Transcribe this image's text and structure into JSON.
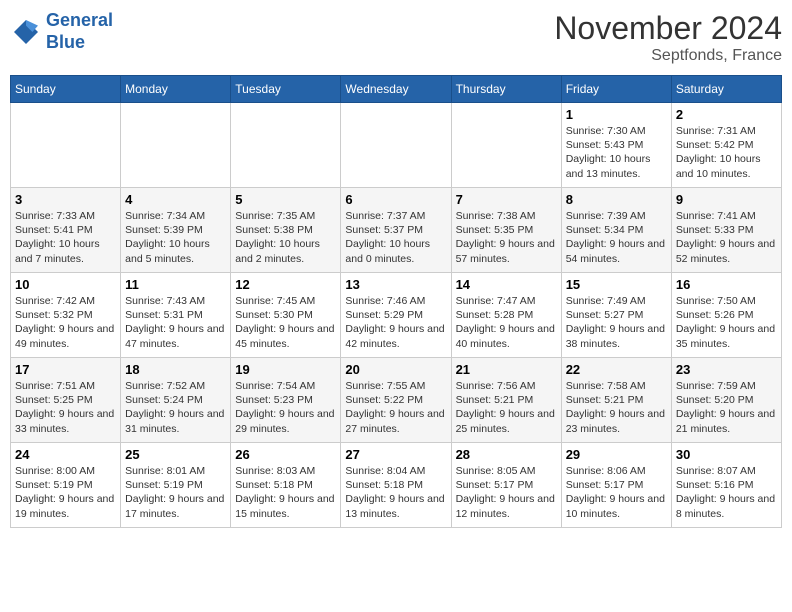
{
  "logo": {
    "line1": "General",
    "line2": "Blue"
  },
  "title": "November 2024",
  "subtitle": "Septfonds, France",
  "weekdays": [
    "Sunday",
    "Monday",
    "Tuesday",
    "Wednesday",
    "Thursday",
    "Friday",
    "Saturday"
  ],
  "weeks": [
    [
      {
        "day": "",
        "info": ""
      },
      {
        "day": "",
        "info": ""
      },
      {
        "day": "",
        "info": ""
      },
      {
        "day": "",
        "info": ""
      },
      {
        "day": "",
        "info": ""
      },
      {
        "day": "1",
        "info": "Sunrise: 7:30 AM\nSunset: 5:43 PM\nDaylight: 10 hours and 13 minutes."
      },
      {
        "day": "2",
        "info": "Sunrise: 7:31 AM\nSunset: 5:42 PM\nDaylight: 10 hours and 10 minutes."
      }
    ],
    [
      {
        "day": "3",
        "info": "Sunrise: 7:33 AM\nSunset: 5:41 PM\nDaylight: 10 hours and 7 minutes."
      },
      {
        "day": "4",
        "info": "Sunrise: 7:34 AM\nSunset: 5:39 PM\nDaylight: 10 hours and 5 minutes."
      },
      {
        "day": "5",
        "info": "Sunrise: 7:35 AM\nSunset: 5:38 PM\nDaylight: 10 hours and 2 minutes."
      },
      {
        "day": "6",
        "info": "Sunrise: 7:37 AM\nSunset: 5:37 PM\nDaylight: 10 hours and 0 minutes."
      },
      {
        "day": "7",
        "info": "Sunrise: 7:38 AM\nSunset: 5:35 PM\nDaylight: 9 hours and 57 minutes."
      },
      {
        "day": "8",
        "info": "Sunrise: 7:39 AM\nSunset: 5:34 PM\nDaylight: 9 hours and 54 minutes."
      },
      {
        "day": "9",
        "info": "Sunrise: 7:41 AM\nSunset: 5:33 PM\nDaylight: 9 hours and 52 minutes."
      }
    ],
    [
      {
        "day": "10",
        "info": "Sunrise: 7:42 AM\nSunset: 5:32 PM\nDaylight: 9 hours and 49 minutes."
      },
      {
        "day": "11",
        "info": "Sunrise: 7:43 AM\nSunset: 5:31 PM\nDaylight: 9 hours and 47 minutes."
      },
      {
        "day": "12",
        "info": "Sunrise: 7:45 AM\nSunset: 5:30 PM\nDaylight: 9 hours and 45 minutes."
      },
      {
        "day": "13",
        "info": "Sunrise: 7:46 AM\nSunset: 5:29 PM\nDaylight: 9 hours and 42 minutes."
      },
      {
        "day": "14",
        "info": "Sunrise: 7:47 AM\nSunset: 5:28 PM\nDaylight: 9 hours and 40 minutes."
      },
      {
        "day": "15",
        "info": "Sunrise: 7:49 AM\nSunset: 5:27 PM\nDaylight: 9 hours and 38 minutes."
      },
      {
        "day": "16",
        "info": "Sunrise: 7:50 AM\nSunset: 5:26 PM\nDaylight: 9 hours and 35 minutes."
      }
    ],
    [
      {
        "day": "17",
        "info": "Sunrise: 7:51 AM\nSunset: 5:25 PM\nDaylight: 9 hours and 33 minutes."
      },
      {
        "day": "18",
        "info": "Sunrise: 7:52 AM\nSunset: 5:24 PM\nDaylight: 9 hours and 31 minutes."
      },
      {
        "day": "19",
        "info": "Sunrise: 7:54 AM\nSunset: 5:23 PM\nDaylight: 9 hours and 29 minutes."
      },
      {
        "day": "20",
        "info": "Sunrise: 7:55 AM\nSunset: 5:22 PM\nDaylight: 9 hours and 27 minutes."
      },
      {
        "day": "21",
        "info": "Sunrise: 7:56 AM\nSunset: 5:21 PM\nDaylight: 9 hours and 25 minutes."
      },
      {
        "day": "22",
        "info": "Sunrise: 7:58 AM\nSunset: 5:21 PM\nDaylight: 9 hours and 23 minutes."
      },
      {
        "day": "23",
        "info": "Sunrise: 7:59 AM\nSunset: 5:20 PM\nDaylight: 9 hours and 21 minutes."
      }
    ],
    [
      {
        "day": "24",
        "info": "Sunrise: 8:00 AM\nSunset: 5:19 PM\nDaylight: 9 hours and 19 minutes."
      },
      {
        "day": "25",
        "info": "Sunrise: 8:01 AM\nSunset: 5:19 PM\nDaylight: 9 hours and 17 minutes."
      },
      {
        "day": "26",
        "info": "Sunrise: 8:03 AM\nSunset: 5:18 PM\nDaylight: 9 hours and 15 minutes."
      },
      {
        "day": "27",
        "info": "Sunrise: 8:04 AM\nSunset: 5:18 PM\nDaylight: 9 hours and 13 minutes."
      },
      {
        "day": "28",
        "info": "Sunrise: 8:05 AM\nSunset: 5:17 PM\nDaylight: 9 hours and 12 minutes."
      },
      {
        "day": "29",
        "info": "Sunrise: 8:06 AM\nSunset: 5:17 PM\nDaylight: 9 hours and 10 minutes."
      },
      {
        "day": "30",
        "info": "Sunrise: 8:07 AM\nSunset: 5:16 PM\nDaylight: 9 hours and 8 minutes."
      }
    ]
  ]
}
